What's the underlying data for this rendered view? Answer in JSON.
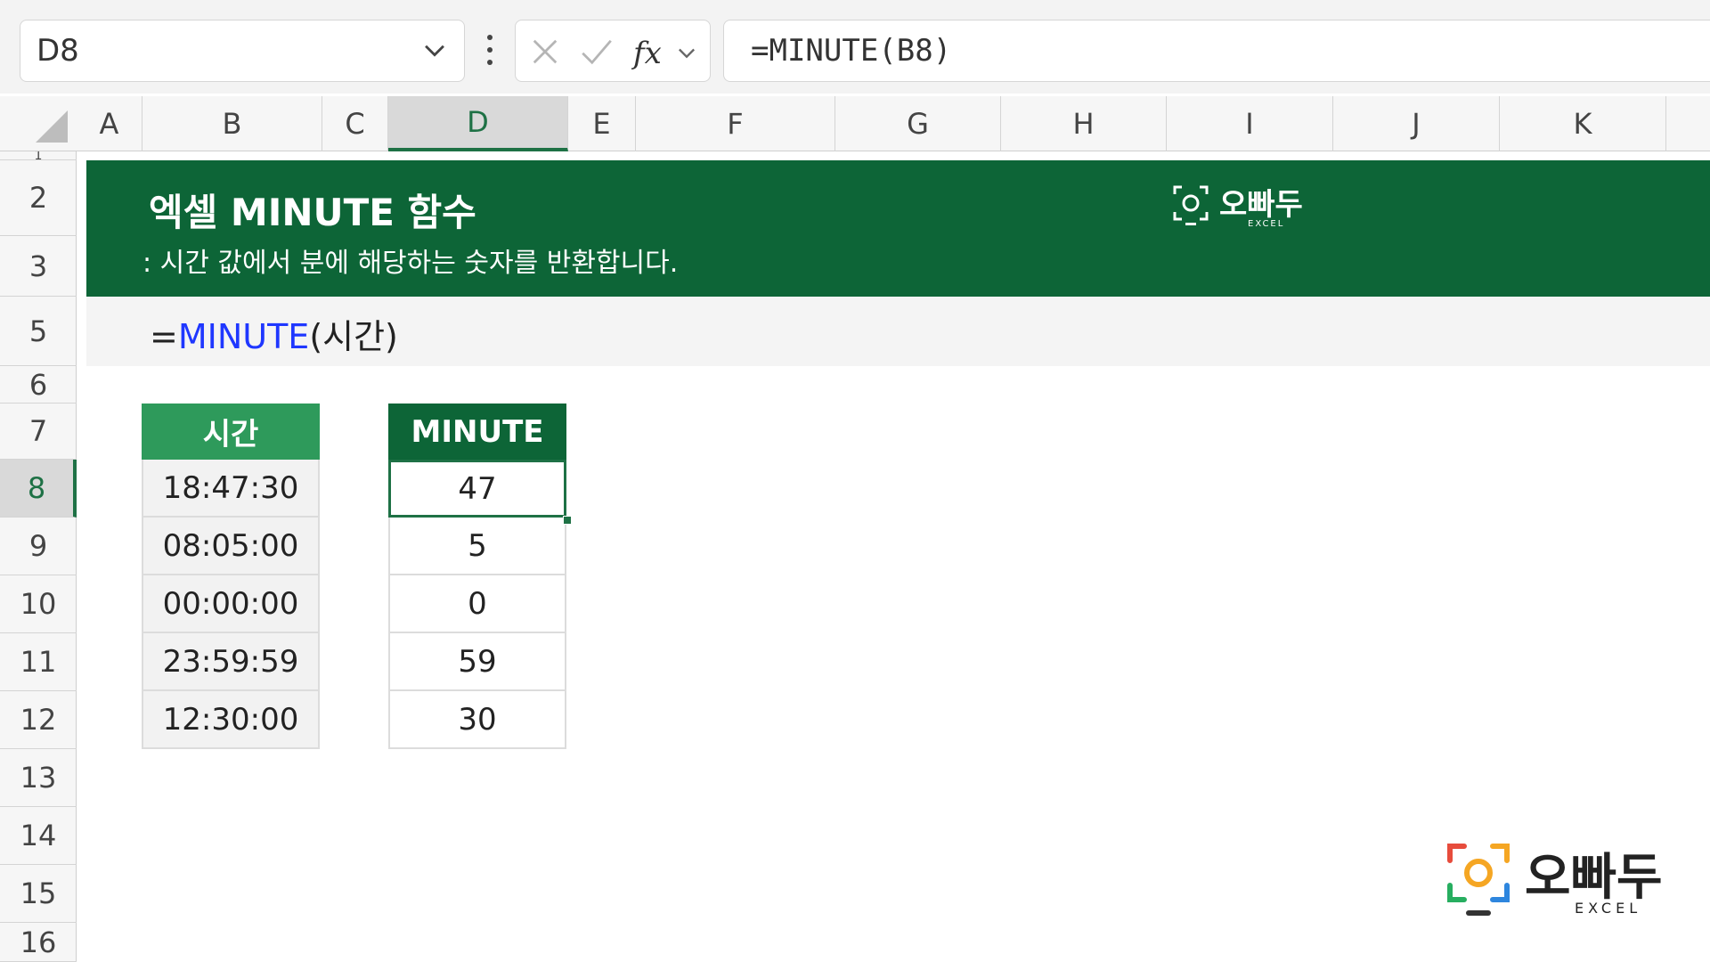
{
  "name_box": "D8",
  "formula_bar": "=MINUTE(B8)",
  "columns": [
    "A",
    "B",
    "C",
    "D",
    "E",
    "F",
    "G",
    "H",
    "I",
    "J",
    "K"
  ],
  "rows": [
    "1",
    "2",
    "3",
    "5",
    "6",
    "7",
    "8",
    "9",
    "10",
    "11",
    "12",
    "13",
    "14",
    "15",
    "16"
  ],
  "banner": {
    "title": "엑셀 MINUTE 함수",
    "subtitle": ": 시간 값에서 분에 해당하는 숫자를 반환합니다.",
    "logo_text": "오빠두",
    "logo_sub": "EXCEL"
  },
  "syntax": {
    "prefix": "=",
    "fn": "MINUTE",
    "args": "(시간)"
  },
  "table_time": {
    "header": "시간",
    "values": [
      "18:47:30",
      "08:05:00",
      "00:00:00",
      "23:59:59",
      "12:30:00"
    ]
  },
  "table_minute": {
    "header": "MINUTE",
    "values": [
      "47",
      "5",
      "0",
      "59",
      "30"
    ]
  },
  "watermark": {
    "text": "오빠두",
    "sub": "EXCEL"
  },
  "colors": {
    "brand_green": "#0d6537",
    "header_green": "#2e9a5b",
    "function_blue": "#1f37ff"
  }
}
